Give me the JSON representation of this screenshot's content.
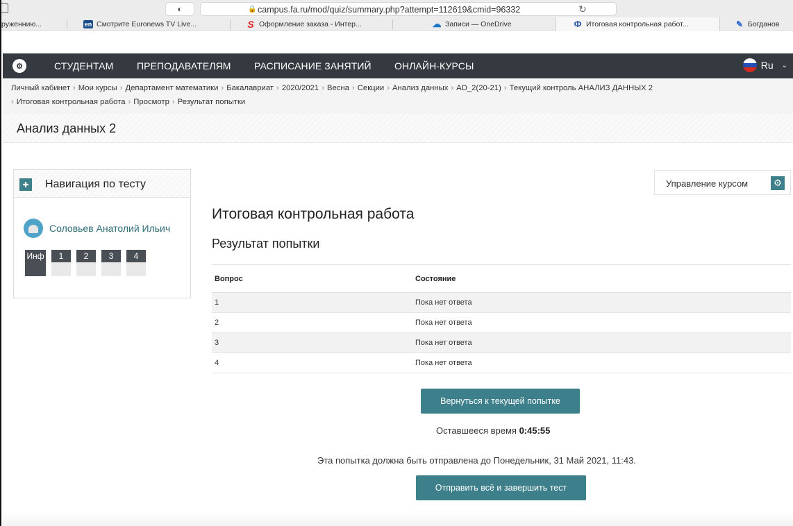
{
  "browser": {
    "url": "campus.fa.ru/mod/quiz/summary.php?attempt=112619&cmid=96332",
    "tabs": [
      {
        "label": "руженнию..."
      },
      {
        "label": "Смотрите Euronews TV Live..."
      },
      {
        "label": "Оформление заказа - Интер..."
      },
      {
        "label": "Записи — OneDrive"
      },
      {
        "label": "Итоговая контрольная работ..."
      },
      {
        "label": "Богданов"
      }
    ]
  },
  "sitenav": {
    "links": [
      "СТУДЕНТАМ",
      "ПРЕПОДАВАТЕЛЯМ",
      "РАСПИСАНИЕ ЗАНЯТИЙ",
      "ОНЛАЙН-КУРСЫ"
    ],
    "lang": "Ru"
  },
  "breadcrumb": [
    "Личный кабинет",
    "Мои курсы",
    "Департамент математики",
    "Бакалавриат",
    "2020/2021",
    "Весна",
    "Секции",
    "Анализ данных",
    "AD_2(20-21)",
    "Текущий контроль АНАЛИЗ ДАННЫХ 2",
    "Итоговая контрольная работа",
    "Просмотр",
    "Результат попытки"
  ],
  "course_title": "Анализ данных 2",
  "nav_block": {
    "title": "Навигация по тесту",
    "user_name": "Соловьев Анатолий Ильич",
    "questions": [
      "Инф",
      "1",
      "2",
      "3",
      "4"
    ]
  },
  "manage_course": "Управление курсом",
  "quiz_title": "Итоговая контрольная работа",
  "section_title": "Результат попытки",
  "table": {
    "headers": [
      "Вопрос",
      "Состояние"
    ],
    "rows": [
      [
        "1",
        "Пока нет ответа"
      ],
      [
        "2",
        "Пока нет ответа"
      ],
      [
        "3",
        "Пока нет ответа"
      ],
      [
        "4",
        "Пока нет ответа"
      ]
    ]
  },
  "return_button": "Вернуться к текущей попытке",
  "timer_label": "Оставшееся время",
  "timer_value": "0:45:55",
  "due_text": "Эта попытка должна быть отправлена до Понедельник, 31 Май 2021, 11:43.",
  "submit_button": "Отправить всё и завершить тест"
}
